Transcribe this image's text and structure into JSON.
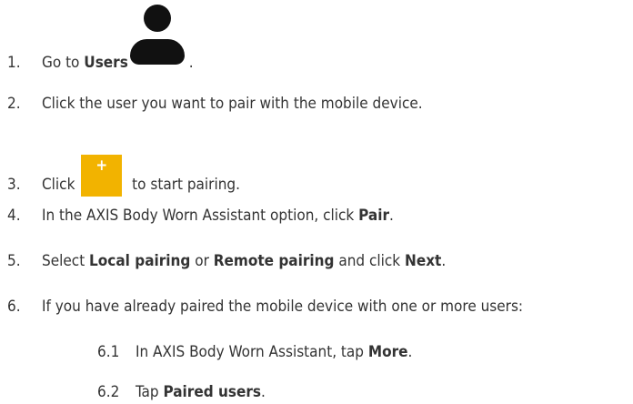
{
  "steps": [
    {
      "num": "1.",
      "t1": "Go to ",
      "b1": "Users",
      "t2": " ."
    },
    {
      "num": "2.",
      "t1": "Click the user you want to pair with the mobile device."
    },
    {
      "num": "3.",
      "t1": "Click ",
      "t2": " to start pairing."
    },
    {
      "num": "4.",
      "t1": "In the AXIS Body Worn Assistant option, click ",
      "b1": "Pair",
      "t2": "."
    },
    {
      "num": "5.",
      "t1": "Select ",
      "b1": "Local pairing",
      "t2": " or ",
      "b2": "Remote pairing",
      "t3": " and click ",
      "b3": "Next",
      "t4": "."
    },
    {
      "num": "6.",
      "t1": "If you have already paired the mobile device with one or more users:"
    }
  ],
  "substeps": [
    {
      "num": "6.1",
      "t1": "In AXIS Body Worn Assistant, tap ",
      "b1": "More",
      "t2": "."
    },
    {
      "num": "6.2",
      "t1": "Tap ",
      "b1": "Paired users",
      "t2": "."
    }
  ],
  "icons": {
    "user": "user-icon",
    "add": "plus-icon",
    "add_glyph": "+",
    "add_color": "#f2b300",
    "user_color": "#111111"
  }
}
